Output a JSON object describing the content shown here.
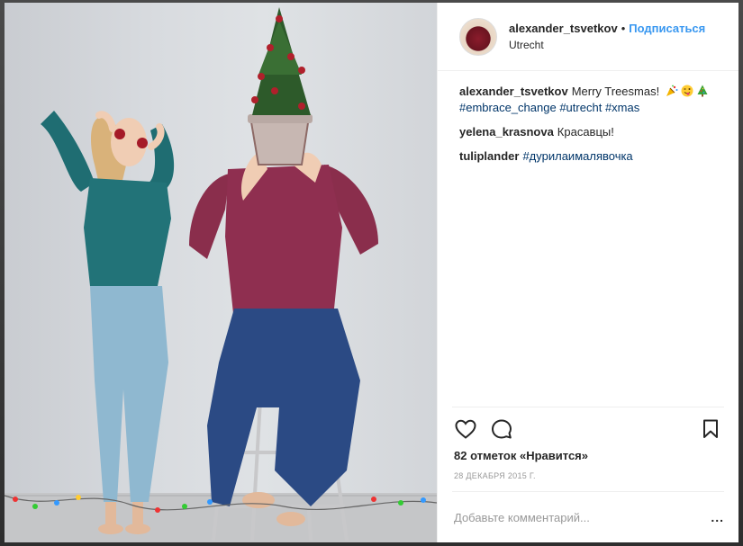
{
  "post": {
    "author": "alexander_tsvetkov",
    "separator": "•",
    "follow_label": "Подписаться",
    "location": "Utrecht"
  },
  "comments": [
    {
      "user": "alexander_tsvetkov",
      "text": "Merry Treesmas!",
      "tags": [
        "#embrace_change",
        "#utrecht",
        "#xmas"
      ],
      "emojis": [
        "party-popper-icon",
        "winking-face-tongue-icon",
        "christmas-tree-icon"
      ]
    },
    {
      "user": "yelena_krasnova",
      "text": "Красавцы!"
    },
    {
      "user": "tuliplander",
      "tags": [
        "#дурилаималявочка"
      ]
    }
  ],
  "actions": {
    "like_icon": "heart-icon",
    "comment_icon": "speech-bubble-icon",
    "save_icon": "bookmark-icon"
  },
  "likes_text": "82 отметок «Нравится»",
  "date": "28 ДЕКАБРЯ 2015 Г.",
  "add_comment": {
    "placeholder": "Добавьте комментарий...",
    "more_label": "..."
  },
  "colors": {
    "accent": "#3897f0",
    "hashtag": "#003569",
    "text": "#262626",
    "muted": "#999999"
  }
}
